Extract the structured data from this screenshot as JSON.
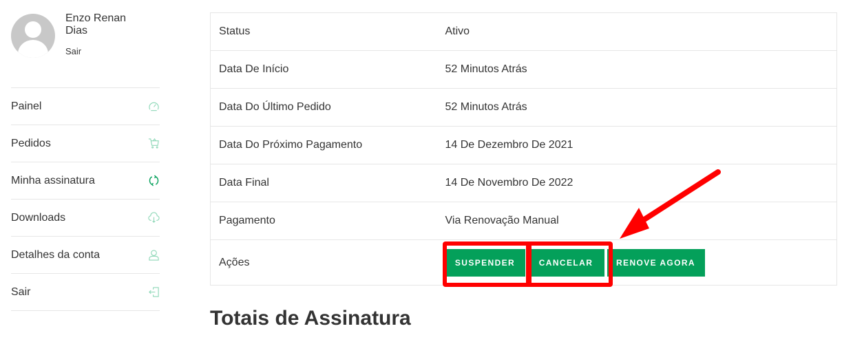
{
  "profile": {
    "name": "Enzo Renan Dias",
    "logout_label": "Sair",
    "avatar_icon": "default-avatar-icon"
  },
  "sidebar": {
    "items": [
      {
        "label": "Painel",
        "icon": "dashboard-gauge-icon",
        "active": false
      },
      {
        "label": "Pedidos",
        "icon": "shopping-cart-icon",
        "active": false
      },
      {
        "label": "Minha assinatura",
        "icon": "refresh-cycle-icon",
        "active": true
      },
      {
        "label": "Downloads",
        "icon": "cloud-download-icon",
        "active": false
      },
      {
        "label": "Detalhes da conta",
        "icon": "user-icon",
        "active": false
      },
      {
        "label": "Sair",
        "icon": "logout-icon",
        "active": false
      }
    ],
    "icon_color": "#8fd8b8",
    "active_icon_color": "#04a05a"
  },
  "subscription": {
    "rows": [
      {
        "key": "Status",
        "value": "Ativo"
      },
      {
        "key": "Data De Início",
        "value": "52 Minutos Atrás"
      },
      {
        "key": "Data Do Último Pedido",
        "value": "52 Minutos Atrás"
      },
      {
        "key": "Data Do Próximo Pagamento",
        "value": "14 De Dezembro De 2021"
      },
      {
        "key": "Data Final",
        "value": "14 De Novembro De 2022"
      },
      {
        "key": "Pagamento",
        "value": "Via Renovação Manual"
      }
    ],
    "actions_label": "Ações",
    "actions": {
      "suspend": "Suspender",
      "cancel": "Cancelar",
      "renew": "Renove Agora"
    },
    "button_color": "#04a05a"
  },
  "totals_heading": "Totais de Assinatura",
  "annotations": {
    "highlight_color": "#ff0000",
    "highlighted_buttons": [
      "Suspender",
      "Cancelar"
    ]
  }
}
